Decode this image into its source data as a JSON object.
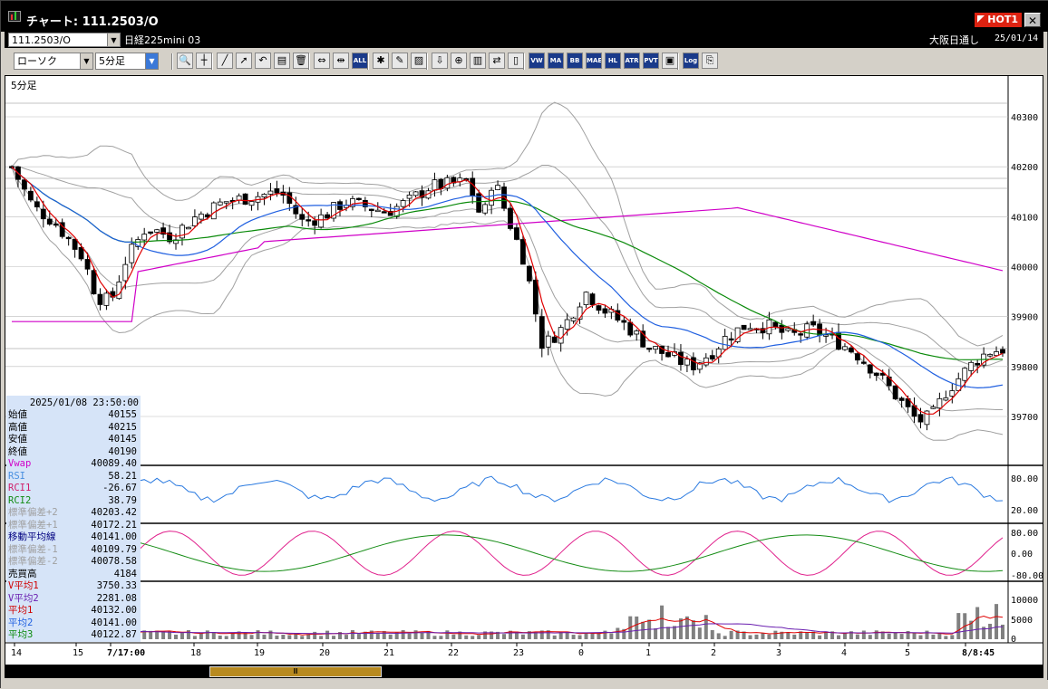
{
  "window": {
    "title": "チャート: 111.2503/O",
    "hot_label": "HOT1",
    "close_label": "✕"
  },
  "symbol_bar": {
    "symbol": "111.2503/O",
    "name": "日経225mini 03",
    "session": "大阪日通し",
    "date": "25/01/14"
  },
  "toolbar": {
    "chart_type": "ローソク",
    "interval": "5分足",
    "icons": [
      "zoom-icon",
      "crosshair-icon",
      "trendline-icon",
      "cursor-icon",
      "undo-icon",
      "copy-icon",
      "delete-icon",
      "fit-icon",
      "fit-all-icon",
      "all-icon",
      "settings-icon",
      "paint-icon",
      "color-icon",
      "download-icon",
      "search-icon",
      "bar-icon",
      "signal-icon",
      "gray-icon",
      "vwap-icon",
      "ma-icon",
      "bb-icon",
      "mae-icon",
      "hl-icon",
      "atr-icon",
      "pvt-icon",
      "window-icon",
      "log-icon",
      "export-icon"
    ],
    "labeled_buttons": {
      "all": "ALL",
      "vwap": "VW",
      "ma": "MA",
      "bb": "BB",
      "mae": "MAE",
      "hl": "HL",
      "atr": "ATR",
      "pvt": "PVT",
      "log": "Log"
    }
  },
  "chart": {
    "panel_label": "5分足",
    "price_ticks": [
      "40300",
      "40200",
      "40100",
      "40000",
      "39900",
      "39800",
      "39700"
    ],
    "rsi_ticks": [
      "80.00",
      "20.00"
    ],
    "rci_ticks": [
      "80.00",
      "0.00",
      "-80.00"
    ],
    "volume_ticks": [
      "10000",
      "5000",
      "0"
    ],
    "x_labels": [
      "14",
      "15",
      "7/17:00",
      "18",
      "19",
      "20",
      "21",
      "22",
      "23",
      "0",
      "1",
      "2",
      "3",
      "4",
      "5",
      "8/8:45"
    ],
    "colors": {
      "up_candle": "#ffffff",
      "down_candle": "#000000",
      "ma1": "#e00000",
      "ma2": "#1f5fe0",
      "ma3": "#0a8a0a",
      "vwap": "#d000c8",
      "bands": "#a0a0a0",
      "rsi": "#2a7ae0",
      "rci1": "#e0208c",
      "rci2": "#148c14",
      "volume": "#808080"
    }
  },
  "info": {
    "datetime": "2025/01/08 23:50:00",
    "rows": [
      {
        "label": "始値",
        "value": "40155",
        "color": "#000000"
      },
      {
        "label": "高値",
        "value": "40215",
        "color": "#000000"
      },
      {
        "label": "安値",
        "value": "40145",
        "color": "#000000"
      },
      {
        "label": "終値",
        "value": "40190",
        "color": "#000000"
      },
      {
        "label": "Vwap",
        "value": "40089.40",
        "color": "#d000c8"
      },
      {
        "label": "RSI",
        "value": "58.21",
        "color": "#4a90e0"
      },
      {
        "label": "RCI1",
        "value": "-26.67",
        "color": "#d0206a"
      },
      {
        "label": "RCI2",
        "value": "38.79",
        "color": "#148c14"
      },
      {
        "label": "標準偏差+2",
        "value": "40203.42",
        "color": "#a0a0a0"
      },
      {
        "label": "標準偏差+1",
        "value": "40172.21",
        "color": "#a0a0a0"
      },
      {
        "label": "移動平均線",
        "value": "40141.00",
        "color": "#000080"
      },
      {
        "label": "標準偏差-1",
        "value": "40109.79",
        "color": "#a0a0a0"
      },
      {
        "label": "標準偏差-2",
        "value": "40078.58",
        "color": "#a0a0a0"
      },
      {
        "label": "売買高",
        "value": "4184",
        "color": "#000000"
      },
      {
        "label": "V平均1",
        "value": "3750.33",
        "color": "#d00000"
      },
      {
        "label": "V平均2",
        "value": "2281.08",
        "color": "#6a1fb0"
      },
      {
        "label": "平均1",
        "value": "40132.00",
        "color": "#d00000"
      },
      {
        "label": "平均2",
        "value": "40141.00",
        "color": "#1f5fe0"
      },
      {
        "label": "平均3",
        "value": "40122.87",
        "color": "#0a8a0a"
      }
    ]
  },
  "scrollbar": {
    "thumb_label": "Ⅲ"
  }
}
